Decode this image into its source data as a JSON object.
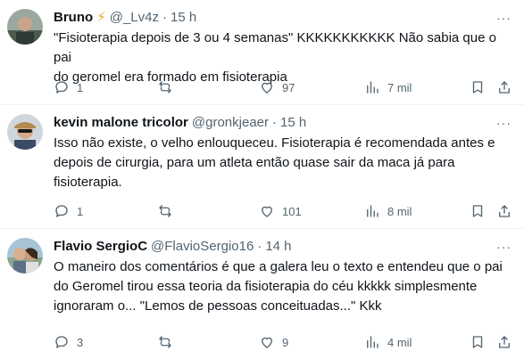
{
  "colors": {
    "text": "#0f1419",
    "secondary": "#536471",
    "divider": "#eff3f4",
    "verified_bolt": "#f5a623"
  },
  "replies": [
    {
      "name": "Bruno",
      "badge": "⚡",
      "handle": "@_Lv4z",
      "time": "15 h",
      "text": "\"Fisioterapia depois de 3 ou 4 semanas\" KKKKKKKKKKK Não sabia que o pai\ndo geromel era formado em fisioterapia",
      "replies": "1",
      "reposts": "",
      "likes": "97",
      "views": "7 mil"
    },
    {
      "name": "kevin malone tricolor",
      "badge": "",
      "handle": "@gronkjeaer",
      "time": "15 h",
      "text": "Isso não existe, o velho enlouqueceu. Fisioterapia é recomendada antes e\ndepois de cirurgia, para um atleta então quase sair da maca já para\nfisioterapia.",
      "replies": "1",
      "reposts": "",
      "likes": "101",
      "views": "8 mil"
    },
    {
      "name": "Flavio SergioC",
      "badge": "",
      "handle": "@FlavioSergio16",
      "time": "14 h",
      "text": "O maneiro dos comentários é que a galera leu o texto e entendeu que o pai\ndo Geromel tirou essa teoria da fisioterapia do céu kkkkk simplesmente\nignoraram o... \"Lemos de pessoas conceituadas...\" Kkk",
      "replies": "3",
      "reposts": "",
      "likes": "9",
      "views": "4 mil"
    }
  ],
  "more_glyph": "···",
  "separator": "·"
}
